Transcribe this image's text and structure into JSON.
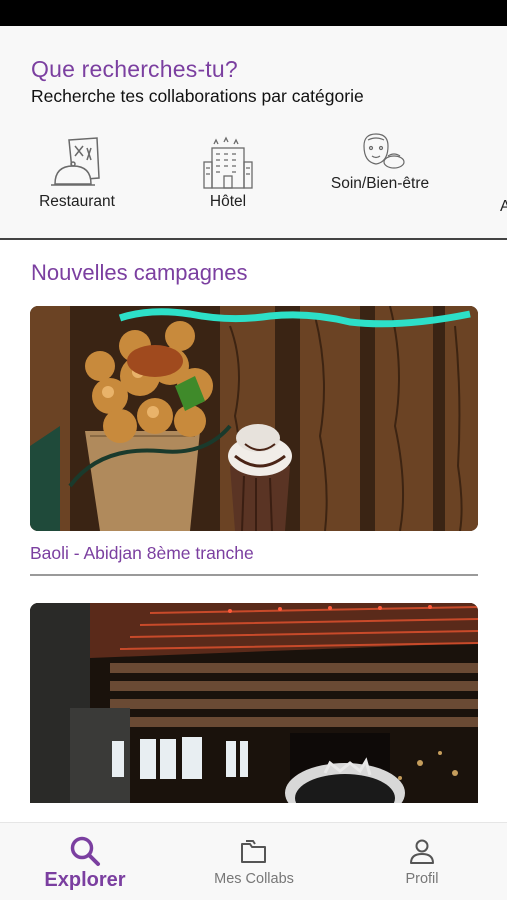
{
  "header": {
    "title": "Que recherches-tu?",
    "subtitle": "Recherche tes collaborations par catégorie"
  },
  "categories": [
    {
      "label": "Restaurant",
      "icon": "restaurant-menu-icon"
    },
    {
      "label": "Hôtel",
      "icon": "hotel-building-icon"
    },
    {
      "label": "Soin/Bien-être",
      "icon": "spa-face-icon"
    },
    {
      "label": "A",
      "icon": ""
    }
  ],
  "campaigns": {
    "title": "Nouvelles campagnes",
    "items": [
      {
        "title": "Baoli - Abidjan 8ème tranche",
        "image": "bubble-waffle-milkshake-photo"
      },
      {
        "title": "",
        "image": "restaurant-terrace-night-photo"
      }
    ]
  },
  "nav": {
    "items": [
      {
        "label": "Explorer",
        "icon": "search-icon",
        "active": true
      },
      {
        "label": "Mes Collabs",
        "icon": "folder-icon",
        "active": false
      },
      {
        "label": "Profil",
        "icon": "user-icon",
        "active": false
      }
    ]
  },
  "colors": {
    "accent": "#7b3fa0",
    "background": "#f8f8f8",
    "inactive": "#777777"
  }
}
